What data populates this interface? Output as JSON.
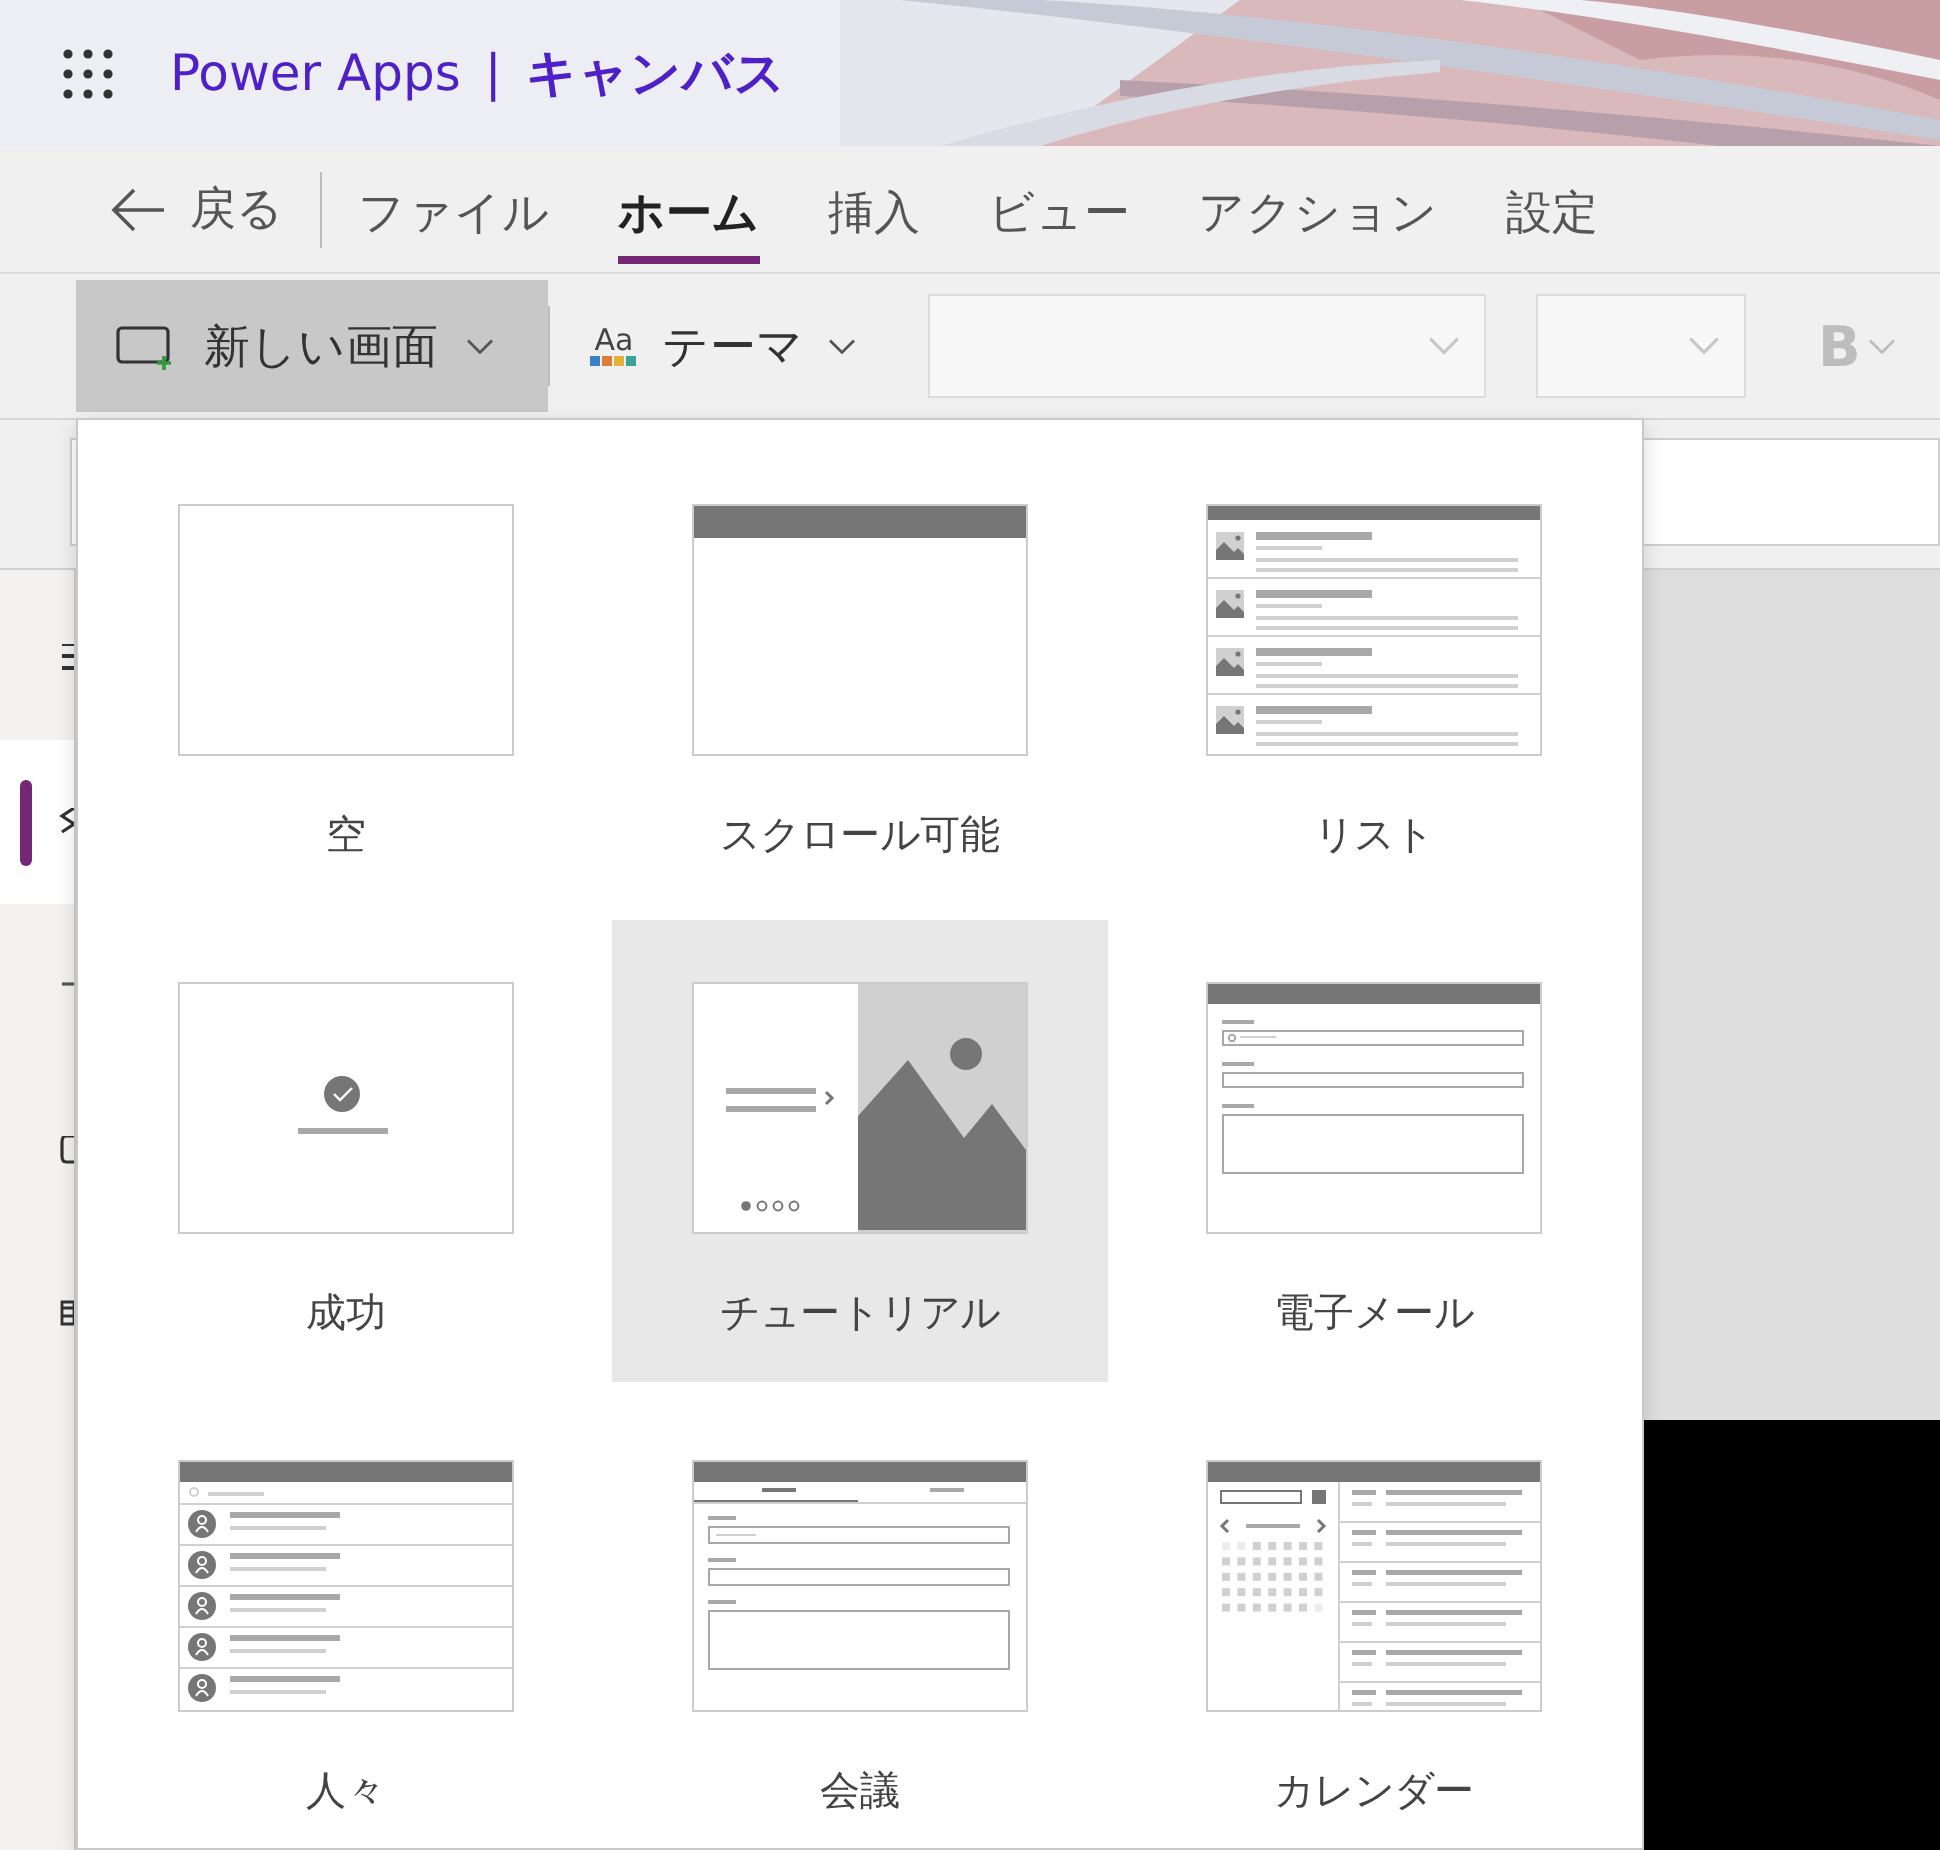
{
  "header": {
    "app_name": "Power Apps",
    "separator": "|",
    "section": "キャンバス"
  },
  "menu": {
    "back": "戻る",
    "tabs": [
      {
        "label": "ファイル",
        "selected": false
      },
      {
        "label": "ホーム",
        "selected": true
      },
      {
        "label": "挿入",
        "selected": false
      },
      {
        "label": "ビュー",
        "selected": false
      },
      {
        "label": "アクション",
        "selected": false
      },
      {
        "label": "設定",
        "selected": false
      }
    ]
  },
  "toolbar": {
    "new_screen": {
      "label": "新しい画面",
      "expanded": true
    },
    "theme": {
      "icon_text": "Aa",
      "label": "テーマ"
    },
    "bold": {
      "label": "B",
      "disabled": true
    }
  },
  "rail": [
    {
      "selected": false
    },
    {
      "selected": true
    },
    {
      "selected": false
    },
    {
      "selected": false
    },
    {
      "selected": false
    }
  ],
  "templates": [
    {
      "kind": "blank",
      "label": "空",
      "selected": false
    },
    {
      "kind": "scrollable",
      "label": "スクロール可能",
      "selected": false
    },
    {
      "kind": "list",
      "label": "リスト",
      "selected": false
    },
    {
      "kind": "success",
      "label": "成功",
      "selected": false
    },
    {
      "kind": "tutorial",
      "label": "チュートリアル",
      "selected": true
    },
    {
      "kind": "email",
      "label": "電子メール",
      "selected": false
    },
    {
      "kind": "people",
      "label": "人々",
      "selected": false
    },
    {
      "kind": "meeting",
      "label": "会議",
      "selected": false
    },
    {
      "kind": "calendar",
      "label": "カレンダー",
      "selected": false
    }
  ]
}
